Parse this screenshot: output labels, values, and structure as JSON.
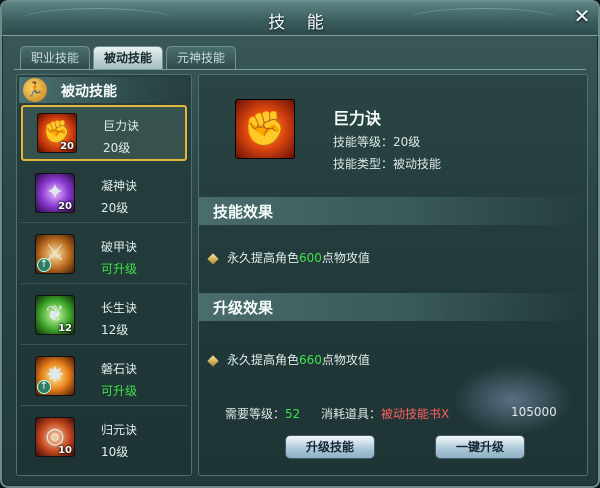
{
  "window": {
    "title": "技 能",
    "close_label": "✕"
  },
  "tabs": [
    {
      "label": "职业技能",
      "active": false
    },
    {
      "label": "被动技能",
      "active": true
    },
    {
      "label": "元神技能",
      "active": false
    }
  ],
  "left_panel": {
    "header": "被动技能",
    "items": [
      {
        "name": "巨力诀",
        "level_text": "20级",
        "badge": "20",
        "icon": "fist-icon",
        "upgradable": false
      },
      {
        "name": "凝神诀",
        "level_text": "20级",
        "badge": "20",
        "icon": "purple-spirit-icon",
        "upgradable": false
      },
      {
        "name": "破甲诀",
        "level_text": "可升级",
        "badge": "",
        "icon": "armor-break-icon",
        "upgradable": true
      },
      {
        "name": "长生诀",
        "level_text": "12级",
        "badge": "12",
        "icon": "leaf-icon",
        "upgradable": false
      },
      {
        "name": "磐石诀",
        "level_text": "可升级",
        "badge": "",
        "icon": "rock-icon",
        "upgradable": true
      },
      {
        "name": "归元诀",
        "level_text": "10级",
        "badge": "10",
        "icon": "orb-icon",
        "upgradable": false
      }
    ]
  },
  "detail": {
    "name": "巨力诀",
    "level_line": "技能等级：20级",
    "type_line": "技能类型：被动技能",
    "effect_title": "技能效果",
    "effect": {
      "prefix": "永久提高角色",
      "value": "600",
      "suffix": "点物攻值"
    },
    "upgrade_title": "升级效果",
    "upgrade_effect": {
      "prefix": "永久提高角色",
      "value": "660",
      "suffix": "点物攻值"
    },
    "need_level_label": "需要等级：",
    "need_level": "52",
    "consume_label": "消耗道具：",
    "consume_item": "被动技能书X",
    "consume_cost": "105000"
  },
  "buttons": {
    "upgrade": "升级技能",
    "one_key": "一键升级"
  },
  "colors": {
    "selected_border": "#e5b43c",
    "upgrade_green": "#3fe34a",
    "item_red": "#ff5e5e"
  }
}
